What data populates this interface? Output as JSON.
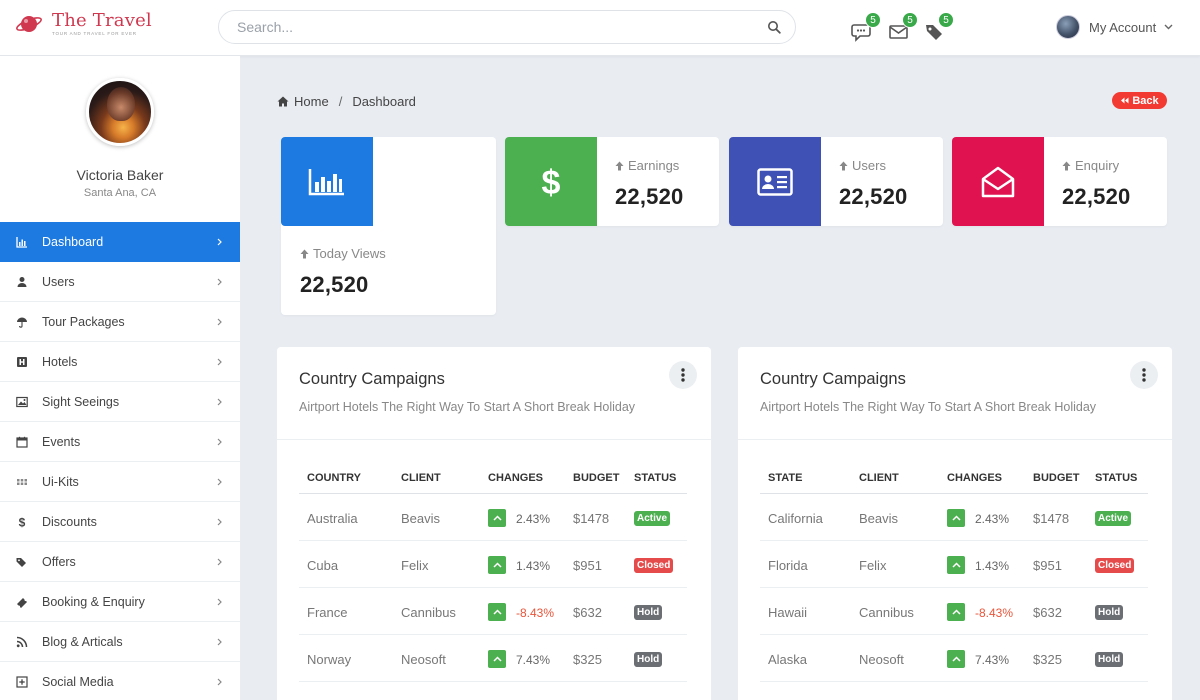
{
  "brand": {
    "title": "The Travel",
    "tagline": "Tour and travel for ever"
  },
  "search": {
    "placeholder": "Search..."
  },
  "header_icons": [
    {
      "name": "chat-icon",
      "badge": "5"
    },
    {
      "name": "mail-icon",
      "badge": "5"
    },
    {
      "name": "tag-icon",
      "badge": "5"
    }
  ],
  "account": {
    "label": "My Account"
  },
  "profile": {
    "name": "Victoria Baker",
    "location": "Santa Ana, CA"
  },
  "nav": [
    {
      "label": "Dashboard",
      "icon": "bar-chart-icon",
      "active": true
    },
    {
      "label": "Users",
      "icon": "user-icon"
    },
    {
      "label": "Tour Packages",
      "icon": "umbrella-icon"
    },
    {
      "label": "Hotels",
      "icon": "hotel-icon"
    },
    {
      "label": "Sight Seeings",
      "icon": "image-icon"
    },
    {
      "label": "Events",
      "icon": "calendar-icon"
    },
    {
      "label": "Ui-Kits",
      "icon": "grid-icon"
    },
    {
      "label": "Discounts",
      "icon": "dollar-icon"
    },
    {
      "label": "Offers",
      "icon": "tags-icon"
    },
    {
      "label": "Booking & Enquiry",
      "icon": "ticket-icon"
    },
    {
      "label": "Blog & Articals",
      "icon": "rss-icon"
    },
    {
      "label": "Social Media",
      "icon": "plus-square-icon"
    }
  ],
  "breadcrumb": {
    "home": "Home",
    "separator": "/",
    "current": "Dashboard"
  },
  "back_label": "Back",
  "stats": [
    {
      "label": "Today Views",
      "value": "22,520",
      "color": "#1d7ae0",
      "icon": "bar-chart-icon"
    },
    {
      "label": "Earnings",
      "value": "22,520",
      "color": "#4caf50",
      "icon": "dollar-icon"
    },
    {
      "label": "Users",
      "value": "22,520",
      "color": "#3f51b5",
      "icon": "id-card-icon"
    },
    {
      "label": "Enquiry",
      "value": "22,520",
      "color": "#e0124f",
      "icon": "envelope-open-icon"
    }
  ],
  "campaigns": [
    {
      "title": "Country Campaigns",
      "subtitle": "Airtport Hotels The Right Way To Start A Short Break Holiday",
      "columns": [
        "COUNTRY",
        "CLIENT",
        "CHANGES",
        "BUDGET",
        "STATUS"
      ],
      "rows": [
        {
          "place": "Australia",
          "client": "Beavis",
          "change": "2.43%",
          "budget": "$1478",
          "status": "Active"
        },
        {
          "place": "Cuba",
          "client": "Felix",
          "change": "1.43%",
          "budget": "$951",
          "status": "Closed"
        },
        {
          "place": "France",
          "client": "Cannibus",
          "change": "-8.43%",
          "budget": "$632",
          "status": "Hold"
        },
        {
          "place": "Norway",
          "client": "Neosoft",
          "change": "7.43%",
          "budget": "$325",
          "status": "Hold"
        }
      ]
    },
    {
      "title": "Country Campaigns",
      "subtitle": "Airtport Hotels The Right Way To Start A Short Break Holiday",
      "columns": [
        "STATE",
        "CLIENT",
        "CHANGES",
        "BUDGET",
        "STATUS"
      ],
      "rows": [
        {
          "place": "California",
          "client": "Beavis",
          "change": "2.43%",
          "budget": "$1478",
          "status": "Active"
        },
        {
          "place": "Florida",
          "client": "Felix",
          "change": "1.43%",
          "budget": "$951",
          "status": "Closed"
        },
        {
          "place": "Hawaii",
          "client": "Cannibus",
          "change": "-8.43%",
          "budget": "$632",
          "status": "Hold"
        },
        {
          "place": "Alaska",
          "client": "Neosoft",
          "change": "7.43%",
          "budget": "$325",
          "status": "Hold"
        }
      ]
    }
  ]
}
